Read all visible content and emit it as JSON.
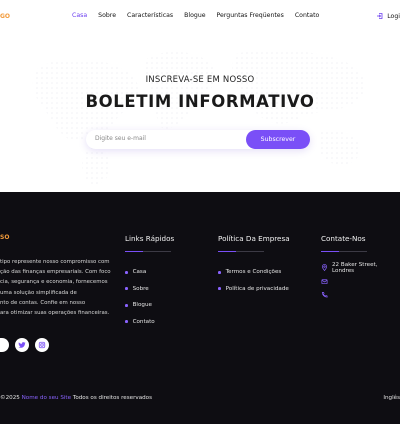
{
  "header": {
    "logo_fragment": "GO",
    "nav": [
      {
        "label": "Casa"
      },
      {
        "label": "Sobre"
      },
      {
        "label": "Características"
      },
      {
        "label": "Blogue"
      },
      {
        "label": "Perguntas Freqüentes"
      },
      {
        "label": "Contato"
      }
    ],
    "login_label": "Logi",
    "accent_color": "#6a3cf0"
  },
  "newsletter": {
    "kicker": "INSCREVA-SE EM NOSSO",
    "title": "BOLETIM INFORMATIVO",
    "email_placeholder": "Digite seu e-mail",
    "subscribe_label": "Subscrever",
    "button_color": "#7a4ff7"
  },
  "footer": {
    "logo_fragment": "SO",
    "description_lines": [
      "tipo represente nosso compromisso com",
      "ção das finanças empresariais. Com foco",
      "cia, segurança e economia, fornecemos",
      "uma solução simplificada de",
      "nto de contas. Confie em nosso",
      "ara otimizar suas operações financeiras."
    ],
    "quick_links": {
      "title": "Links Rápidos",
      "items": [
        "Casa",
        "Sobre",
        "Blogue",
        "Contato"
      ]
    },
    "policy": {
      "title": "Política Da Empresa",
      "items": [
        "Termos e Condições",
        "Política de privacidade"
      ]
    },
    "contact": {
      "title": "Contate-Nos",
      "address": "22 Baker Street, Londres"
    },
    "socials": [
      "facebook-icon",
      "twitter-icon",
      "instagram-icon"
    ],
    "copyright_prefix": "©2025",
    "site_name": "Nome do seu Site",
    "copyright_suffix": "Todos os direitos reservados",
    "language": "Inglês"
  }
}
